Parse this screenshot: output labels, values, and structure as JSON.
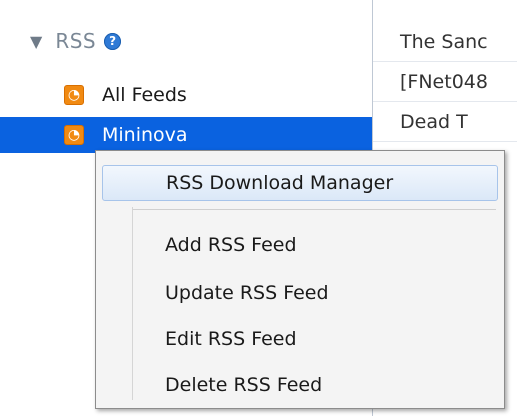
{
  "sidebar": {
    "section_title": "RSS",
    "help_icon": "?",
    "items": [
      {
        "label": "All Feeds",
        "icon": "rss-feed-icon"
      },
      {
        "label": "Mininova",
        "icon": "rss-feed-icon",
        "selected": true
      }
    ]
  },
  "right_panel": {
    "rows": [
      "The Sanc",
      "[FNet048",
      "Dead T"
    ]
  },
  "context_menu": {
    "items": [
      {
        "label": "RSS Download Manager"
      },
      {
        "label": "Add RSS Feed"
      },
      {
        "label": "Update RSS Feed"
      },
      {
        "label": "Edit RSS Feed"
      },
      {
        "label": "Delete RSS Feed"
      }
    ]
  },
  "colors": {
    "selection": "#0a62e0",
    "rss_icon": "#f18a12",
    "help_icon": "#2f7ad6",
    "menu_highlight_border": "#a7c4ea"
  }
}
